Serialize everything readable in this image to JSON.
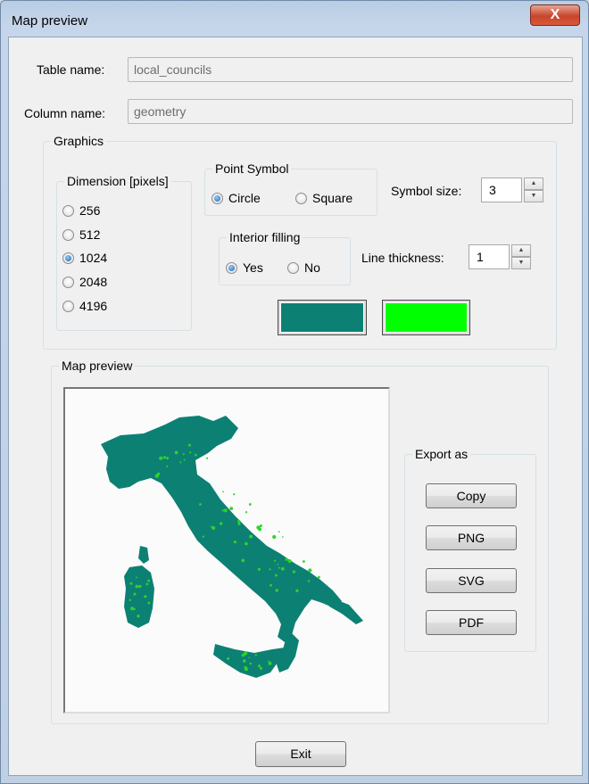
{
  "window": {
    "title": "Map preview",
    "close_label": "X"
  },
  "table_name": {
    "label": "Table name:",
    "value": "local_councils"
  },
  "column_name": {
    "label": "Column name:",
    "value": "geometry"
  },
  "graphics": {
    "legend": "Graphics",
    "dimension": {
      "legend": "Dimension [pixels]",
      "options": [
        "256",
        "512",
        "1024",
        "2048",
        "4196"
      ],
      "selected": "1024"
    },
    "point_symbol": {
      "legend": "Point Symbol",
      "options": [
        "Circle",
        "Square"
      ],
      "selected": "Circle"
    },
    "interior_filling": {
      "legend": "Interior filling",
      "options": [
        "Yes",
        "No"
      ],
      "selected": "Yes"
    },
    "symbol_size": {
      "label": "Symbol size:",
      "value": "3"
    },
    "line_thickness": {
      "label": "Line thickness:",
      "value": "1"
    },
    "colors": {
      "line": "#0d8074",
      "fill": "#00ff00"
    }
  },
  "map_preview": {
    "legend": "Map preview",
    "map_color": "#0d8074",
    "point_color": "#2bd42b"
  },
  "export": {
    "legend": "Export as",
    "buttons": [
      "Copy",
      "PNG",
      "SVG",
      "PDF"
    ]
  },
  "exit_label": "Exit"
}
